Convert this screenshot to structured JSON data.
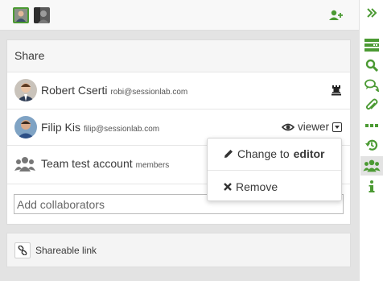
{
  "colors": {
    "accent": "#4b9a33",
    "panel_bg": "#e3e3e3"
  },
  "topbar": {
    "avatars": [
      "user-avatar-icon",
      "user-avatar-icon"
    ],
    "add_user_icon": "add-user-icon"
  },
  "share_panel": {
    "title": "Share",
    "collaborators": [
      {
        "name": "Robert Cserti",
        "email": "robi@sessionlab.com",
        "role_icon": "rook-icon"
      },
      {
        "name": "Filip Kis",
        "email": "filip@sessionlab.com",
        "role": "viewer"
      },
      {
        "name": "Team test account",
        "email": "members",
        "icon": "team-icon"
      }
    ],
    "add_placeholder": "Add collaborators"
  },
  "role_menu": {
    "change_prefix": "Change to",
    "change_role": "editor",
    "remove_label": "Remove"
  },
  "link_panel": {
    "label": "Shareable link"
  },
  "sidebar": {
    "icons": [
      "double-chevron-right-icon",
      "agenda-icon",
      "search-icon",
      "comments-icon",
      "attachment-icon",
      "more-icon",
      "history-icon",
      "team-icon",
      "info-icon"
    ],
    "active": "team-icon"
  }
}
